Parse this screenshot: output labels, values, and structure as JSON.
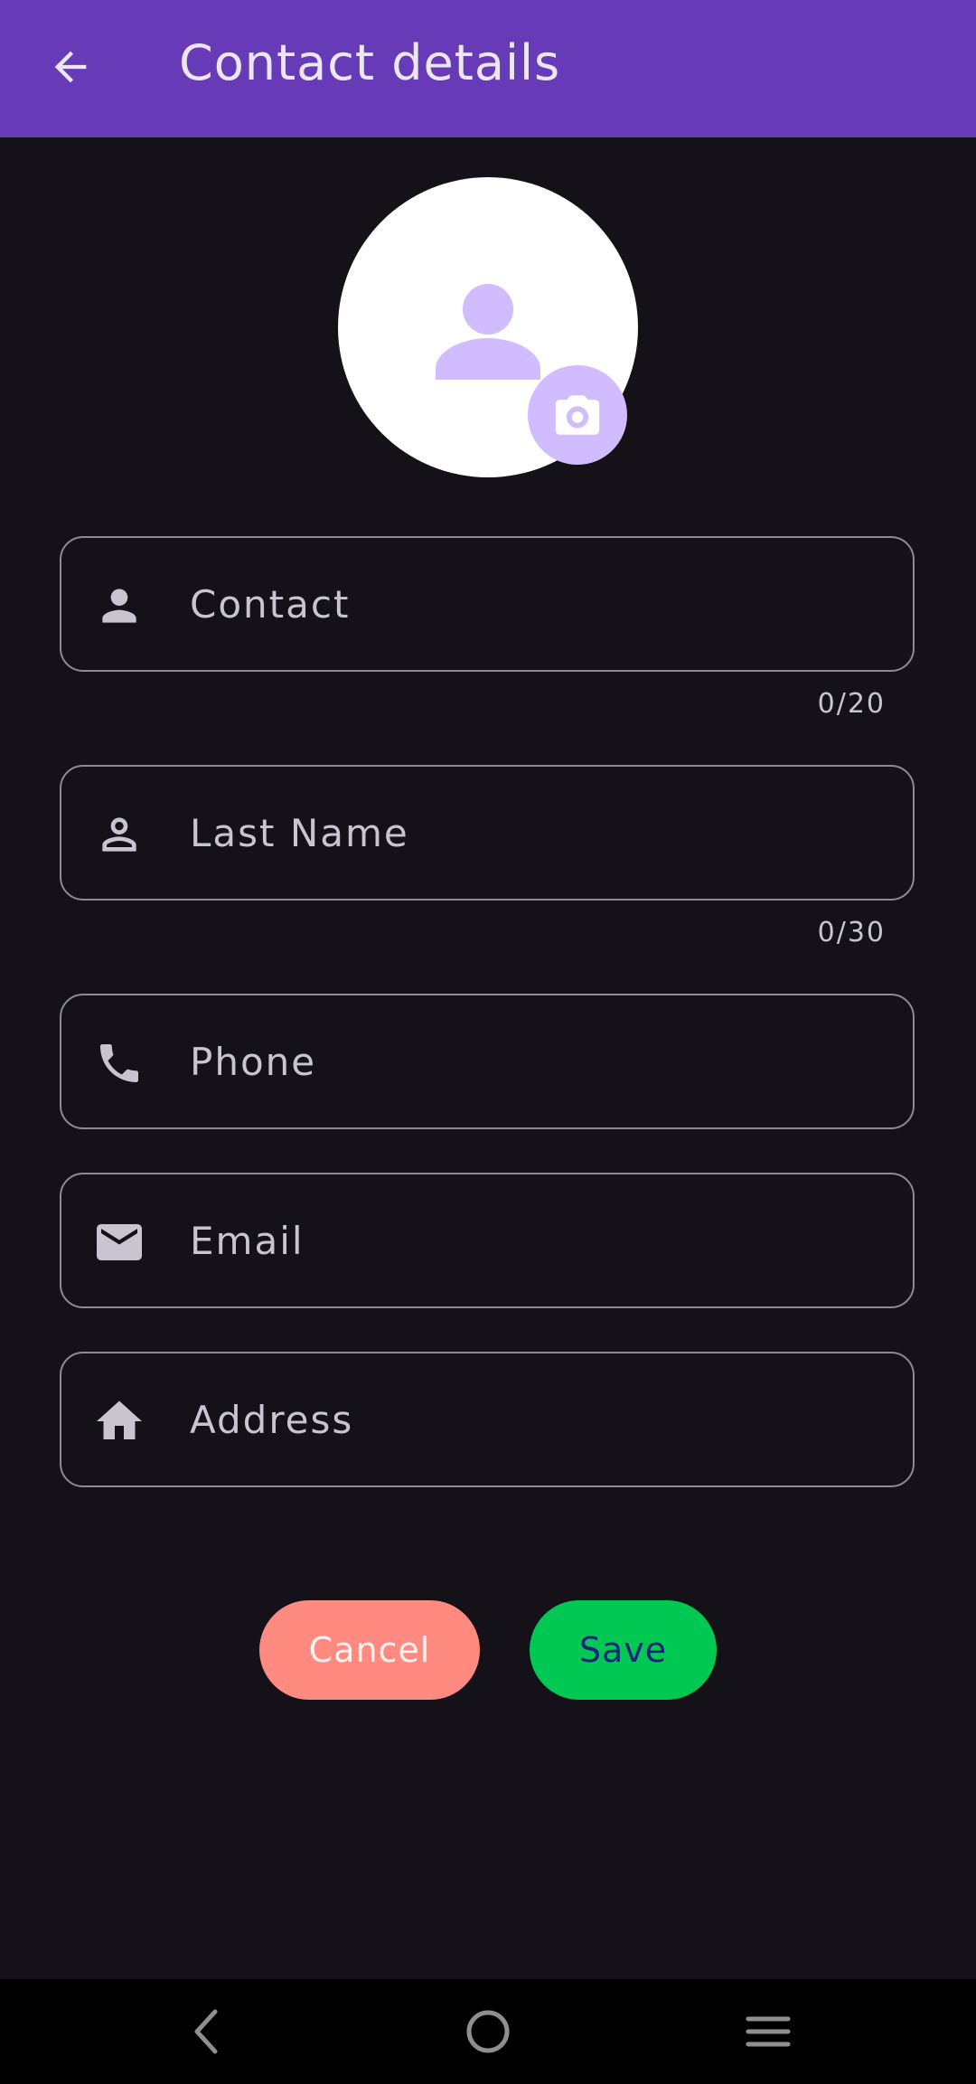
{
  "app_bar": {
    "title": "Contact details",
    "back_icon": "arrow-back-icon"
  },
  "avatar": {
    "icon": "person-icon",
    "camera_icon": "camera-icon"
  },
  "fields": [
    {
      "label": "Contact",
      "icon": "person-filled-icon",
      "counter": "0/20"
    },
    {
      "label": "Last Name",
      "icon": "person-outline-icon",
      "counter": "0/30"
    },
    {
      "label": "Phone",
      "icon": "phone-icon"
    },
    {
      "label": "Email",
      "icon": "email-icon"
    },
    {
      "label": "Address",
      "icon": "home-icon"
    }
  ],
  "buttons": {
    "cancel": "Cancel",
    "save": "Save"
  },
  "colors": {
    "app_bar": "#673AB7",
    "background": "#141218",
    "accent": "#D0BCFF",
    "cancel": "#FF8A80",
    "save": "#00C853"
  },
  "system_nav": {
    "back_icon": "nav-back-icon",
    "home_icon": "nav-home-icon",
    "recents_icon": "nav-menu-icon"
  }
}
